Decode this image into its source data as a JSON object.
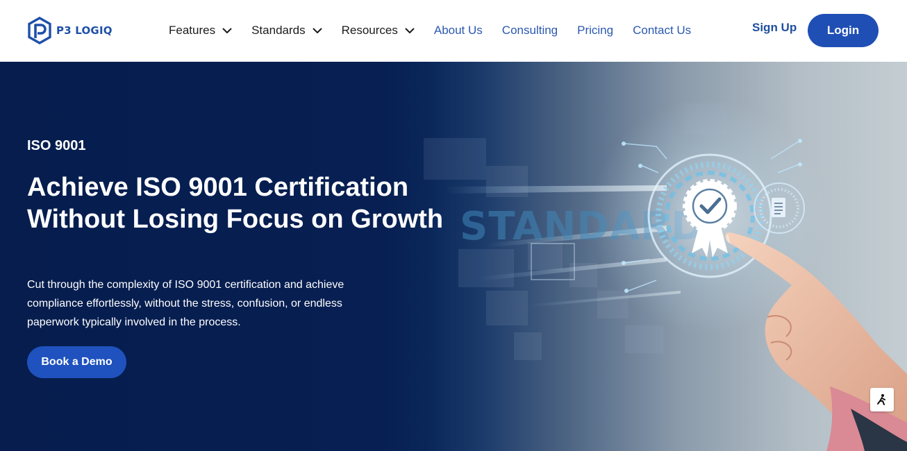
{
  "brand": {
    "name": "P3 LOGIQ",
    "logo_icon": "p3-logo-icon",
    "color": "#1e50a8"
  },
  "nav": {
    "items": [
      {
        "label": "Features",
        "dropdown": true
      },
      {
        "label": "Standards",
        "dropdown": true
      },
      {
        "label": "Resources",
        "dropdown": true
      },
      {
        "label": "About Us",
        "dropdown": false
      },
      {
        "label": "Consulting",
        "dropdown": false
      },
      {
        "label": "Pricing",
        "dropdown": false
      },
      {
        "label": "Contact Us",
        "dropdown": false
      }
    ],
    "signup_label": "Sign Up",
    "login_label": "Login"
  },
  "hero": {
    "eyebrow": "ISO 9001",
    "headline": "Achieve ISO 9001 Certification Without Losing Focus on Growth",
    "subcopy": "Cut through the complexity of ISO 9001 certification and achieve compliance effortlessly, without the stress, confusion, or endless paperwork typically involved in the process.",
    "cta_label": "Book a Demo",
    "image_text": "STANDARD"
  },
  "colors": {
    "hero_bg": "#061d4e",
    "primary_button": "#1f52be",
    "nav_link_blue": "#2a58b0"
  },
  "icons": {
    "dropdown": "chevron-down-icon",
    "badge": "certification-badge-icon",
    "document": "document-icon",
    "accessibility": "accessibility-icon"
  }
}
